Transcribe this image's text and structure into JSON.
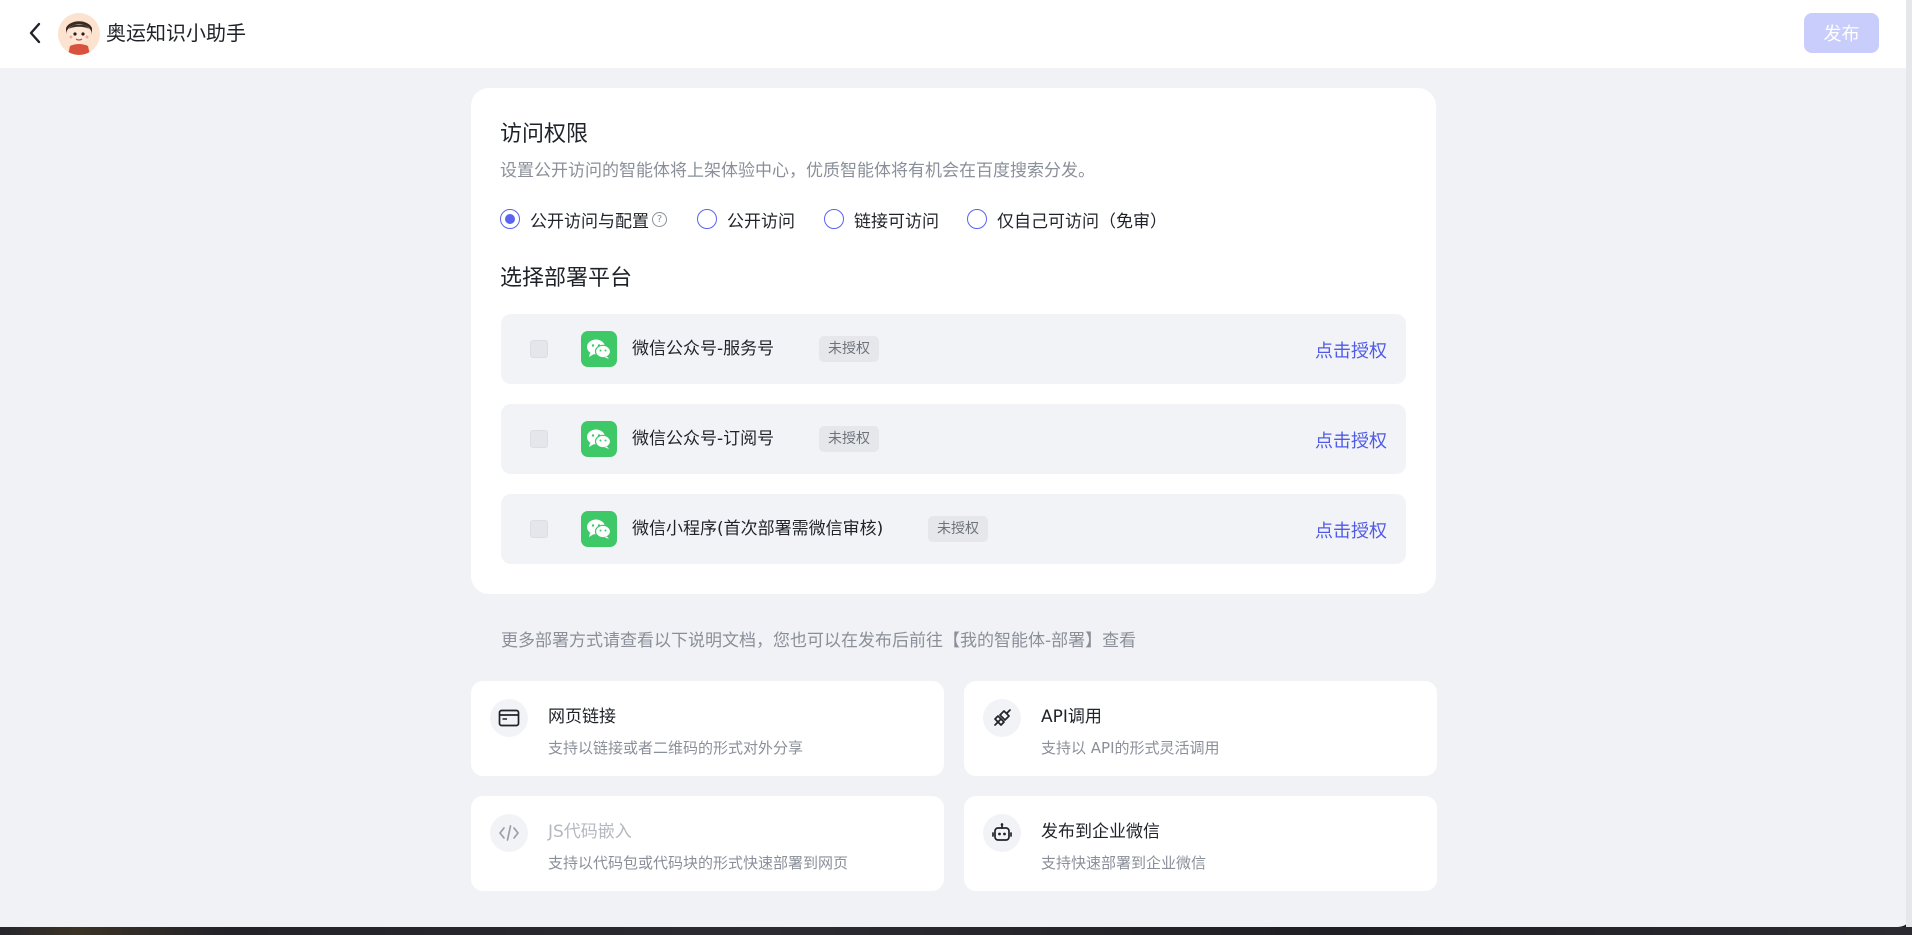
{
  "header": {
    "title": "奥运知识小助手",
    "publish_label": "发布",
    "back_icon": "chevron-left-icon",
    "avatar": "agent-avatar"
  },
  "access": {
    "title": "访问权限",
    "description": "设置公开访问的智能体将上架体验中心，优质智能体将有机会在百度搜索分发。",
    "options": [
      {
        "label": "公开访问与配置",
        "selected": true,
        "help": "?"
      },
      {
        "label": "公开访问",
        "selected": false
      },
      {
        "label": "链接可访问",
        "selected": false
      },
      {
        "label": "仅自己可访问（免审）",
        "selected": false
      }
    ]
  },
  "platforms": {
    "title": "选择部署平台",
    "items": [
      {
        "name": "微信公众号-服务号",
        "badge": "未授权",
        "action": "点击授权",
        "icon": "wechat-icon"
      },
      {
        "name": "微信公众号-订阅号",
        "badge": "未授权",
        "action": "点击授权",
        "icon": "wechat-icon"
      },
      {
        "name": "微信小程序(首次部署需微信审核)",
        "badge": "未授权",
        "action": "点击授权",
        "icon": "wechat-icon"
      }
    ]
  },
  "more": {
    "text": "更多部署方式请查看以下说明文档，您也可以在发布后前往【我的智能体-部署】查看",
    "options": [
      {
        "title": "网页链接",
        "desc": "支持以链接或者二维码的形式对外分享",
        "icon": "browser-window-icon",
        "disabled": false
      },
      {
        "title": "API调用",
        "desc": "支持以 API的形式灵活调用",
        "icon": "plug-icon",
        "disabled": false
      },
      {
        "title": "JS代码嵌入",
        "desc": "支持以代码包或代码块的形式快速部署到网页",
        "icon": "code-icon",
        "disabled": true
      },
      {
        "title": "发布到企业微信",
        "desc": "支持快速部署到企业微信",
        "icon": "robot-icon",
        "disabled": false
      }
    ]
  },
  "colors": {
    "accent": "#5b63f0",
    "link": "#4f5ae8",
    "wechat_green": "#3fc868",
    "publish_disabled": "#c9cdfb"
  }
}
